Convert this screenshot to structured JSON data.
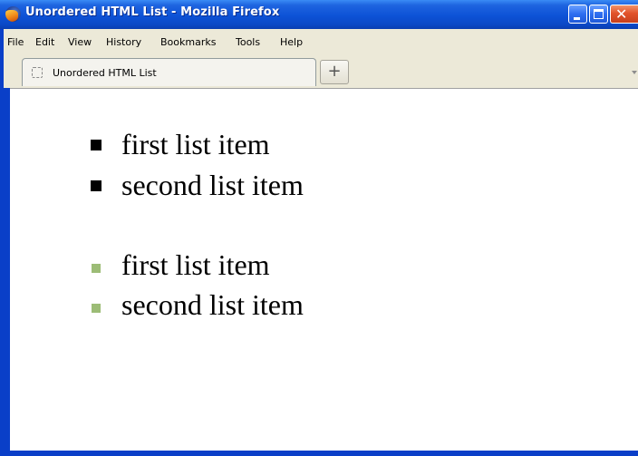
{
  "window": {
    "title": "Unordered HTML List - Mozilla Firefox",
    "close_glyph": "✕"
  },
  "menu": {
    "items": [
      {
        "label": "File"
      },
      {
        "label": "Edit"
      },
      {
        "label": "View"
      },
      {
        "label": "History"
      },
      {
        "label": "Bookmarks"
      },
      {
        "label": "Tools"
      },
      {
        "label": "Help"
      }
    ]
  },
  "tabs": [
    {
      "label": "Unordered HTML List",
      "active": true
    }
  ],
  "new_tab_label": "+",
  "page": {
    "lists": [
      {
        "bullet_color": "#000000",
        "items": [
          "first list item",
          "second list item"
        ]
      },
      {
        "bullet_color": "#9cbc76",
        "items": [
          "first list item",
          "second list item"
        ]
      }
    ]
  },
  "colors": {
    "titlebar": "#0d52d6",
    "chrome": "#ece9d8",
    "page_background": "#ffffff",
    "square_bullet_black": "#000000",
    "square_bullet_green": "#9cbc76"
  },
  "icons": {
    "app": "firefox-icon",
    "minimize": "minimize-icon",
    "maximize": "maximize-icon",
    "close": "close-icon",
    "tab": "blank-page-icon",
    "new_tab": "plus-icon",
    "tab_list": "chevron-down-icon"
  }
}
